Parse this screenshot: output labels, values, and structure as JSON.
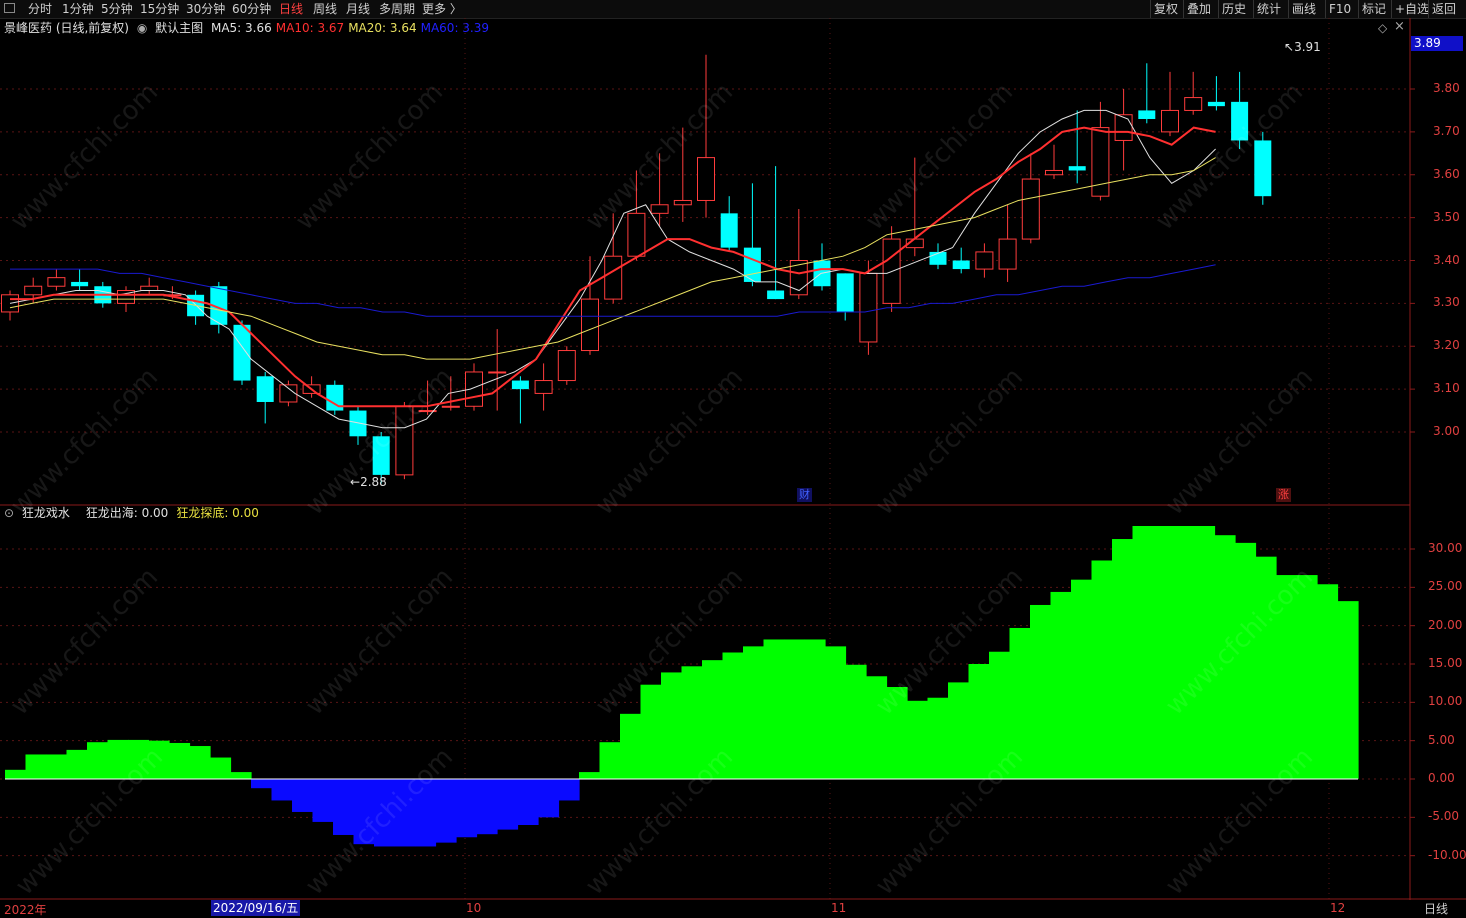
{
  "toolbar": {
    "periods": [
      "分时",
      "1分钟",
      "5分钟",
      "15分钟",
      "30分钟",
      "60分钟",
      "日线",
      "周线",
      "月线",
      "多周期",
      "更多 〉"
    ],
    "active_period": "日线",
    "right_buttons": [
      "复权",
      "叠加",
      "历史",
      "统计",
      "画线",
      "F10",
      "标记",
      "+自选",
      "返回"
    ]
  },
  "main_panel": {
    "stock_title": "景峰医药 (日线,前复权)",
    "indicator_name": "默认主图",
    "ma_labels": [
      {
        "text": "MA5: 3.66",
        "color": "#e0e0e0"
      },
      {
        "text": "MA10: 3.67",
        "color": "#ff3030"
      },
      {
        "text": "MA20: 3.64",
        "color": "#e8e060"
      },
      {
        "text": "MA60: 3.39",
        "color": "#2020ff"
      }
    ],
    "current_price": "3.89",
    "high_label": "3.91",
    "low_label": "2.88",
    "y_axis_labels": [
      "3.80",
      "3.70",
      "3.60",
      "3.50",
      "3.40",
      "3.30",
      "3.20",
      "3.10",
      "3.00"
    ],
    "events": [
      {
        "text": "财",
        "color": "#4060ff",
        "bg": "#101060"
      },
      {
        "text": "涨",
        "color": "#ff4040",
        "bg": "#501010"
      }
    ]
  },
  "sub_panel": {
    "indicator_name": "狂龙戏水",
    "labels": [
      {
        "text": "狂龙出海: 0.00",
        "color": "#e0e0e0"
      },
      {
        "text": "狂龙探底: 0.00",
        "color": "#e8e040"
      }
    ],
    "y_axis_labels": [
      "30.00",
      "25.00",
      "20.00",
      "15.00",
      "10.00",
      "5.00",
      "0.00",
      "-5.00",
      "-10.00"
    ]
  },
  "x_axis": {
    "labels": [
      "2022年",
      "10",
      "11",
      "12"
    ],
    "selected_date": "2022/09/16/五",
    "period_button": "日线"
  },
  "watermark": "www.cfchi.com",
  "chart_data": {
    "type": "candlestick",
    "series": [
      {
        "name": "MA5",
        "color": "#e0e0e0",
        "values": [
          3.3,
          3.31,
          3.32,
          3.33,
          3.33,
          3.32,
          3.33,
          3.33,
          3.32,
          3.27,
          3.24,
          3.17,
          3.13,
          3.09,
          3.06,
          3.03,
          3.02,
          3.01,
          3.01,
          3.03,
          3.09,
          3.1,
          3.12,
          3.14,
          3.17,
          3.24,
          3.31,
          3.4,
          3.51,
          3.53,
          3.45,
          3.42,
          3.4,
          3.38,
          3.35,
          3.35,
          3.33,
          3.37,
          3.38,
          3.37,
          3.37,
          3.39,
          3.41,
          3.43,
          3.51,
          3.58,
          3.65,
          3.7,
          3.73,
          3.75,
          3.75,
          3.73,
          3.64,
          3.58,
          3.61,
          3.66
        ]
      },
      {
        "name": "MA10",
        "color": "#ff3030",
        "values": [
          3.31,
          3.31,
          3.32,
          3.32,
          3.32,
          3.32,
          3.32,
          3.32,
          3.31,
          3.3,
          3.28,
          3.23,
          3.18,
          3.13,
          3.09,
          3.06,
          3.06,
          3.06,
          3.06,
          3.06,
          3.07,
          3.08,
          3.09,
          3.13,
          3.17,
          3.25,
          3.33,
          3.36,
          3.39,
          3.42,
          3.45,
          3.45,
          3.43,
          3.42,
          3.4,
          3.38,
          3.37,
          3.38,
          3.38,
          3.37,
          3.4,
          3.44,
          3.48,
          3.52,
          3.56,
          3.59,
          3.63,
          3.66,
          3.7,
          3.71,
          3.7,
          3.7,
          3.69,
          3.67,
          3.71,
          3.7
        ]
      },
      {
        "name": "MA20",
        "color": "#e8e060",
        "values": [
          3.29,
          3.3,
          3.31,
          3.31,
          3.31,
          3.31,
          3.31,
          3.31,
          3.3,
          3.29,
          3.28,
          3.27,
          3.25,
          3.23,
          3.21,
          3.2,
          3.19,
          3.18,
          3.18,
          3.17,
          3.17,
          3.17,
          3.18,
          3.19,
          3.2,
          3.21,
          3.23,
          3.25,
          3.27,
          3.29,
          3.31,
          3.33,
          3.35,
          3.36,
          3.37,
          3.38,
          3.39,
          3.4,
          3.41,
          3.43,
          3.46,
          3.47,
          3.48,
          3.49,
          3.5,
          3.52,
          3.54,
          3.55,
          3.56,
          3.57,
          3.58,
          3.59,
          3.6,
          3.6,
          3.61,
          3.64
        ]
      },
      {
        "name": "MA60",
        "color": "#1a1ad0",
        "values": [
          3.38,
          3.38,
          3.38,
          3.38,
          3.38,
          3.37,
          3.37,
          3.36,
          3.35,
          3.34,
          3.33,
          3.32,
          3.31,
          3.3,
          3.3,
          3.29,
          3.29,
          3.28,
          3.28,
          3.27,
          3.27,
          3.27,
          3.27,
          3.27,
          3.27,
          3.27,
          3.27,
          3.27,
          3.27,
          3.27,
          3.27,
          3.27,
          3.27,
          3.27,
          3.27,
          3.27,
          3.28,
          3.28,
          3.28,
          3.28,
          3.29,
          3.29,
          3.3,
          3.3,
          3.31,
          3.32,
          3.32,
          3.33,
          3.34,
          3.34,
          3.35,
          3.36,
          3.36,
          3.37,
          3.38,
          3.39
        ]
      }
    ],
    "candles": [
      [
        3.28,
        3.32,
        3.33,
        3.26
      ],
      [
        3.32,
        3.34,
        3.36,
        3.3
      ],
      [
        3.34,
        3.36,
        3.38,
        3.33
      ],
      [
        3.35,
        3.34,
        3.38,
        3.33
      ],
      [
        3.34,
        3.3,
        3.35,
        3.29
      ],
      [
        3.3,
        3.33,
        3.34,
        3.28
      ],
      [
        3.33,
        3.34,
        3.36,
        3.32
      ],
      [
        3.32,
        3.32,
        3.34,
        3.31
      ],
      [
        3.32,
        3.27,
        3.33,
        3.25
      ],
      [
        3.34,
        3.25,
        3.35,
        3.23
      ],
      [
        3.25,
        3.12,
        3.26,
        3.11
      ],
      [
        3.13,
        3.07,
        3.14,
        3.02
      ],
      [
        3.07,
        3.11,
        3.12,
        3.06
      ],
      [
        3.09,
        3.11,
        3.13,
        3.08
      ],
      [
        3.11,
        3.05,
        3.12,
        3.04
      ],
      [
        3.05,
        2.99,
        3.06,
        2.97
      ],
      [
        2.99,
        2.9,
        3.0,
        2.88
      ],
      [
        2.9,
        3.06,
        3.07,
        2.89
      ],
      [
        3.05,
        3.05,
        3.12,
        3.04
      ],
      [
        3.06,
        3.06,
        3.13,
        3.05
      ],
      [
        3.06,
        3.14,
        3.16,
        3.05
      ],
      [
        3.14,
        3.14,
        3.24,
        3.05
      ],
      [
        3.12,
        3.1,
        3.13,
        3.02
      ],
      [
        3.09,
        3.12,
        3.16,
        3.05
      ],
      [
        3.12,
        3.19,
        3.2,
        3.11
      ],
      [
        3.19,
        3.31,
        3.41,
        3.18
      ],
      [
        3.31,
        3.41,
        3.51,
        3.3
      ],
      [
        3.41,
        3.51,
        3.61,
        3.4
      ],
      [
        3.51,
        3.53,
        3.65,
        3.48
      ],
      [
        3.53,
        3.54,
        3.71,
        3.49
      ],
      [
        3.54,
        3.64,
        3.88,
        3.5
      ],
      [
        3.51,
        3.43,
        3.55,
        3.42
      ],
      [
        3.43,
        3.35,
        3.58,
        3.34
      ],
      [
        3.33,
        3.31,
        3.62,
        3.31
      ],
      [
        3.32,
        3.4,
        3.52,
        3.31
      ],
      [
        3.4,
        3.34,
        3.44,
        3.33
      ],
      [
        3.37,
        3.28,
        3.37,
        3.26
      ],
      [
        3.21,
        3.37,
        3.4,
        3.18
      ],
      [
        3.3,
        3.45,
        3.48,
        3.28
      ],
      [
        3.43,
        3.45,
        3.64,
        3.41
      ],
      [
        3.42,
        3.39,
        3.44,
        3.38
      ],
      [
        3.4,
        3.38,
        3.43,
        3.37
      ],
      [
        3.38,
        3.42,
        3.44,
        3.36
      ],
      [
        3.38,
        3.45,
        3.53,
        3.35
      ],
      [
        3.45,
        3.59,
        3.65,
        3.44
      ],
      [
        3.6,
        3.61,
        3.67,
        3.59
      ],
      [
        3.62,
        3.61,
        3.75,
        3.58
      ],
      [
        3.55,
        3.71,
        3.77,
        3.54
      ],
      [
        3.68,
        3.74,
        3.8,
        3.61
      ],
      [
        3.75,
        3.73,
        3.86,
        3.72
      ],
      [
        3.7,
        3.75,
        3.84,
        3.69
      ],
      [
        3.75,
        3.78,
        3.84,
        3.74
      ],
      [
        3.77,
        3.76,
        3.83,
        3.75
      ],
      [
        3.77,
        3.68,
        3.84,
        3.66
      ],
      [
        3.68,
        3.55,
        3.7,
        3.53
      ]
    ],
    "oscillator": {
      "name": "狂龙戏水",
      "values": [
        1.2,
        3.2,
        3.2,
        3.8,
        4.8,
        5.1,
        5.1,
        5.0,
        4.7,
        4.3,
        2.8,
        0.9,
        -1.2,
        -2.8,
        -4.3,
        -5.6,
        -7.3,
        -8.5,
        -8.8,
        -8.8,
        -8.8,
        -8.3,
        -7.6,
        -7.2,
        -6.6,
        -6.0,
        -5.0,
        -2.8,
        0.9,
        4.8,
        8.5,
        12.3,
        13.9,
        14.7,
        15.5,
        16.5,
        17.3,
        18.2,
        18.2,
        18.2,
        17.3,
        14.9,
        13.4,
        12.0,
        10.2,
        10.6,
        12.6,
        15.0,
        16.6,
        19.7,
        22.7,
        24.4,
        26.0,
        28.5,
        31.3,
        33.0,
        33.0,
        33.0,
        33.0,
        31.8,
        30.8,
        29.0,
        26.6,
        26.6,
        25.4,
        23.2
      ]
    }
  }
}
